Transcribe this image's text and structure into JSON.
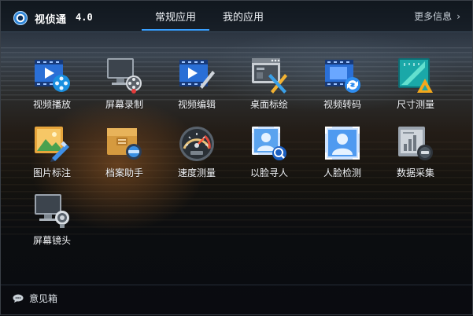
{
  "app": {
    "title": "视侦通",
    "version": "4.0"
  },
  "tabs": [
    {
      "label": "常规应用",
      "active": true
    },
    {
      "label": "我的应用",
      "active": false
    }
  ],
  "more_label": "更多信息",
  "apps": [
    {
      "label": "视频播放",
      "icon": "video-play-icon"
    },
    {
      "label": "屏幕录制",
      "icon": "screen-record-icon"
    },
    {
      "label": "视频编辑",
      "icon": "video-edit-icon"
    },
    {
      "label": "桌面标绘",
      "icon": "desktop-annotate-icon"
    },
    {
      "label": "视频转码",
      "icon": "video-transcode-icon"
    },
    {
      "label": "尺寸测量",
      "icon": "ruler-measure-icon"
    },
    {
      "label": "图片标注",
      "icon": "image-annotate-icon"
    },
    {
      "label": "档案助手",
      "icon": "archive-assistant-icon"
    },
    {
      "label": "速度测量",
      "icon": "speedometer-icon"
    },
    {
      "label": "以脸寻人",
      "icon": "face-search-icon"
    },
    {
      "label": "人脸检测",
      "icon": "face-detect-icon"
    },
    {
      "label": "数据采集",
      "icon": "data-collect-icon"
    },
    {
      "label": "屏幕镜头",
      "icon": "screen-camera-icon"
    }
  ],
  "footer": {
    "feedback_label": "意见箱"
  },
  "colors": {
    "accent": "#3aa0ff"
  }
}
